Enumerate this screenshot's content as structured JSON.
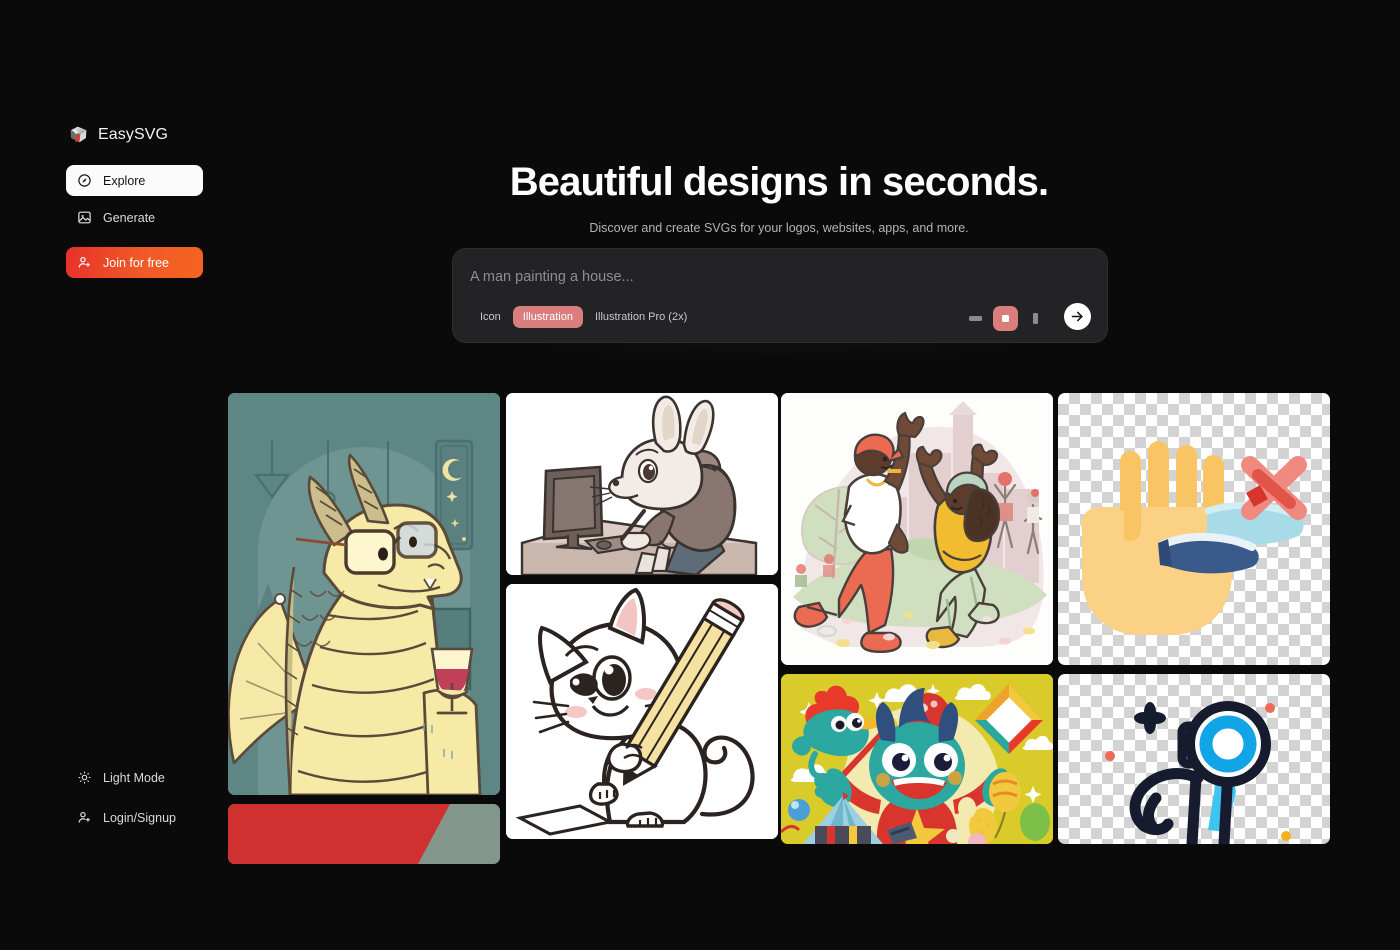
{
  "brand": {
    "name": "EasySVG",
    "logo_icon": "cube-logo-icon"
  },
  "sidebar": {
    "items": [
      {
        "label": "Explore",
        "icon": "compass-icon",
        "active": true
      },
      {
        "label": "Generate",
        "icon": "image-icon",
        "active": false
      },
      {
        "label": "Join for free",
        "icon": "user-plus-icon",
        "cta": true
      }
    ],
    "bottom_items": [
      {
        "label": "Light Mode",
        "icon": "sun-icon"
      },
      {
        "label": "Login/Signup",
        "icon": "user-plus-icon"
      }
    ]
  },
  "hero": {
    "title": "Beautiful designs in seconds.",
    "subtitle": "Discover and create SVGs for your logos, websites, apps, and more."
  },
  "prompt": {
    "value": "",
    "placeholder": "A man painting a house...",
    "modes": [
      {
        "label": "Icon",
        "selected": false
      },
      {
        "label": "Illustration",
        "selected": true
      },
      {
        "label": "Illustration Pro (2x)",
        "selected": false
      }
    ],
    "aspect_ratios": [
      {
        "name": "landscape",
        "selected": false
      },
      {
        "name": "square",
        "selected": true
      },
      {
        "name": "portrait",
        "selected": false
      }
    ],
    "submit_icon": "arrow-right-icon"
  },
  "colors": {
    "background": "#0a0a0a",
    "accent_red": "#e8302a",
    "accent_orange": "#f4641f",
    "mode_selected": "#da7d7d",
    "prompt_bg": "#232325",
    "sidebar_active_bg": "#fbfbfb"
  },
  "gallery": {
    "columns": [
      {
        "cards": [
          {
            "name": "dragon-with-glasses-wine",
            "alt": "Dragon wearing glasses holding a glass of wine",
            "bg": "#5c8583"
          },
          {
            "name": "red-partial-card",
            "alt": "Red illustration card partially visible",
            "bg": "#cf3030"
          }
        ]
      },
      {
        "cards": [
          {
            "name": "rabbit-at-computer",
            "alt": "Rabbit in a hoodie drawing at a computer desk",
            "bg": "#ffffff"
          },
          {
            "name": "cat-with-pencil",
            "alt": "Line-art cat holding a pencil and drawing on paper",
            "bg": "#ffffff"
          }
        ]
      },
      {
        "cards": [
          {
            "name": "people-dancing-park",
            "alt": "Two people dancing in a park with city skyline",
            "bg": "#ffffff"
          },
          {
            "name": "carnival-monster",
            "alt": "Colorful carnival monster with balloon and kite",
            "bg": "#d9cc2a"
          }
        ]
      },
      {
        "cards": [
          {
            "name": "hand-no-toothbrush",
            "alt": "Hand with red X over a toothbrush, transparent background",
            "bg": "transparent"
          },
          {
            "name": "photographer-stick-figure",
            "alt": "Stick figure photographer with camera, transparent background",
            "bg": "transparent"
          }
        ]
      }
    ]
  }
}
